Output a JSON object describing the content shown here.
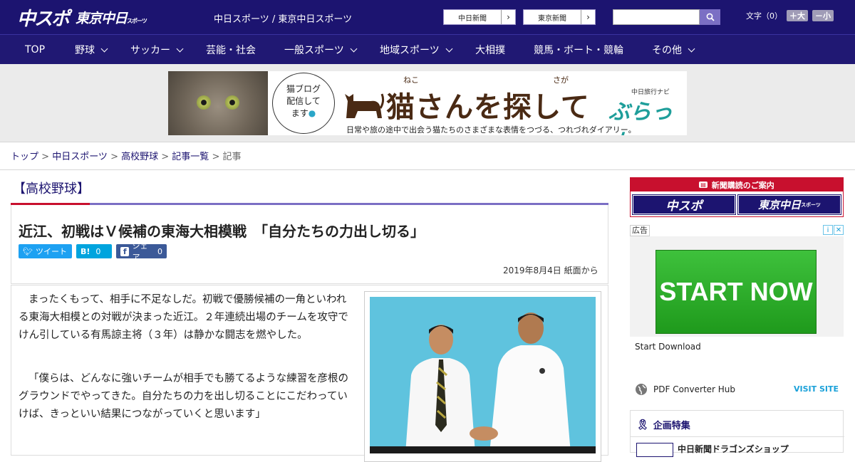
{
  "header": {
    "logo_main": "中スポ",
    "logo_tokyo": "東京中日",
    "logo_tokyo_sub": "スポーツ",
    "site_links": "中日スポーツ / 東京中日スポーツ",
    "paper_buttons": [
      "中日新聞",
      "東京新聞"
    ],
    "search_placeholder": "",
    "font_size_label": "文字（0）",
    "font_plus": "＋大",
    "font_minus": "－小"
  },
  "nav": {
    "items": [
      {
        "label": "TOP",
        "dropdown": false
      },
      {
        "label": "野球",
        "dropdown": true
      },
      {
        "label": "サッカー",
        "dropdown": true
      },
      {
        "label": "芸能・社会",
        "dropdown": false
      },
      {
        "label": "一般スポーツ",
        "dropdown": true
      },
      {
        "label": "地域スポーツ",
        "dropdown": true
      },
      {
        "label": "大相撲",
        "dropdown": false
      },
      {
        "label": "競馬・ボート・競輪",
        "dropdown": false
      },
      {
        "label": "その他",
        "dropdown": true
      }
    ]
  },
  "banner": {
    "bubble": [
      "猫ブログ",
      "配信して",
      "ます"
    ],
    "ruby_neko": "ねこ",
    "ruby_saga": "さが",
    "title": "猫さんを探して",
    "brand_small": "中日旅行ナビ",
    "brand": "ぶらっ人",
    "subtitle": "日常や旅の途中で出会う猫たちのさまざまな表情をつづる、つれづれダイアリー。"
  },
  "breadcrumb": {
    "links": [
      "トップ",
      "中日スポーツ",
      "高校野球",
      "記事一覧"
    ],
    "current": "記事",
    "separator": " > "
  },
  "article": {
    "category": "【高校野球】",
    "title": "近江、初戦はＶ候補の東海大相模戦　「自分たちの力出し切る」",
    "share": {
      "tweet": "ツイート",
      "hatena": "B!",
      "hatena_count": "0",
      "facebook": "シェア",
      "facebook_count": "0"
    },
    "date": "2019年8月4日 紙面から",
    "paragraphs": [
      "まったくもって、相手に不足なしだ。初戦で優勝候補の一角といわれる東海大相模との対戦が決まった近江。２年連続出場のチームを攻守でけん引している有馬諒主将（３年）は静かな闘志を燃やした。",
      "「僕らは、どんなに強いチームが相手でも勝てるような練習を彦根のグラウンドでやってきた。自分たちの力を出し切ることにこだわっていけば、きっといい結果につながっていくと思います」"
    ]
  },
  "sidebar": {
    "subscribe_head": "新聞購読のご案内",
    "sub_logo_1": "中スポ",
    "sub_logo_2": "東京中日",
    "sub_logo_2_small": "スポーツ",
    "ad_label": "広告",
    "ad_button": "START NOW",
    "ad_title": "Start Download",
    "ad_advertiser": "PDF Converter Hub",
    "ad_visit": "VISIT SITE",
    "kikaku_title": "企画特集",
    "kikaku_item": "中日新聞ドラゴンズショップ"
  },
  "colors": {
    "brand_navy": "#1c1470",
    "accent_purple": "#7b6fc4",
    "accent_red": "#c8102e",
    "twitter": "#1da1f2",
    "hatena": "#00a4de",
    "facebook": "#3b5998"
  }
}
